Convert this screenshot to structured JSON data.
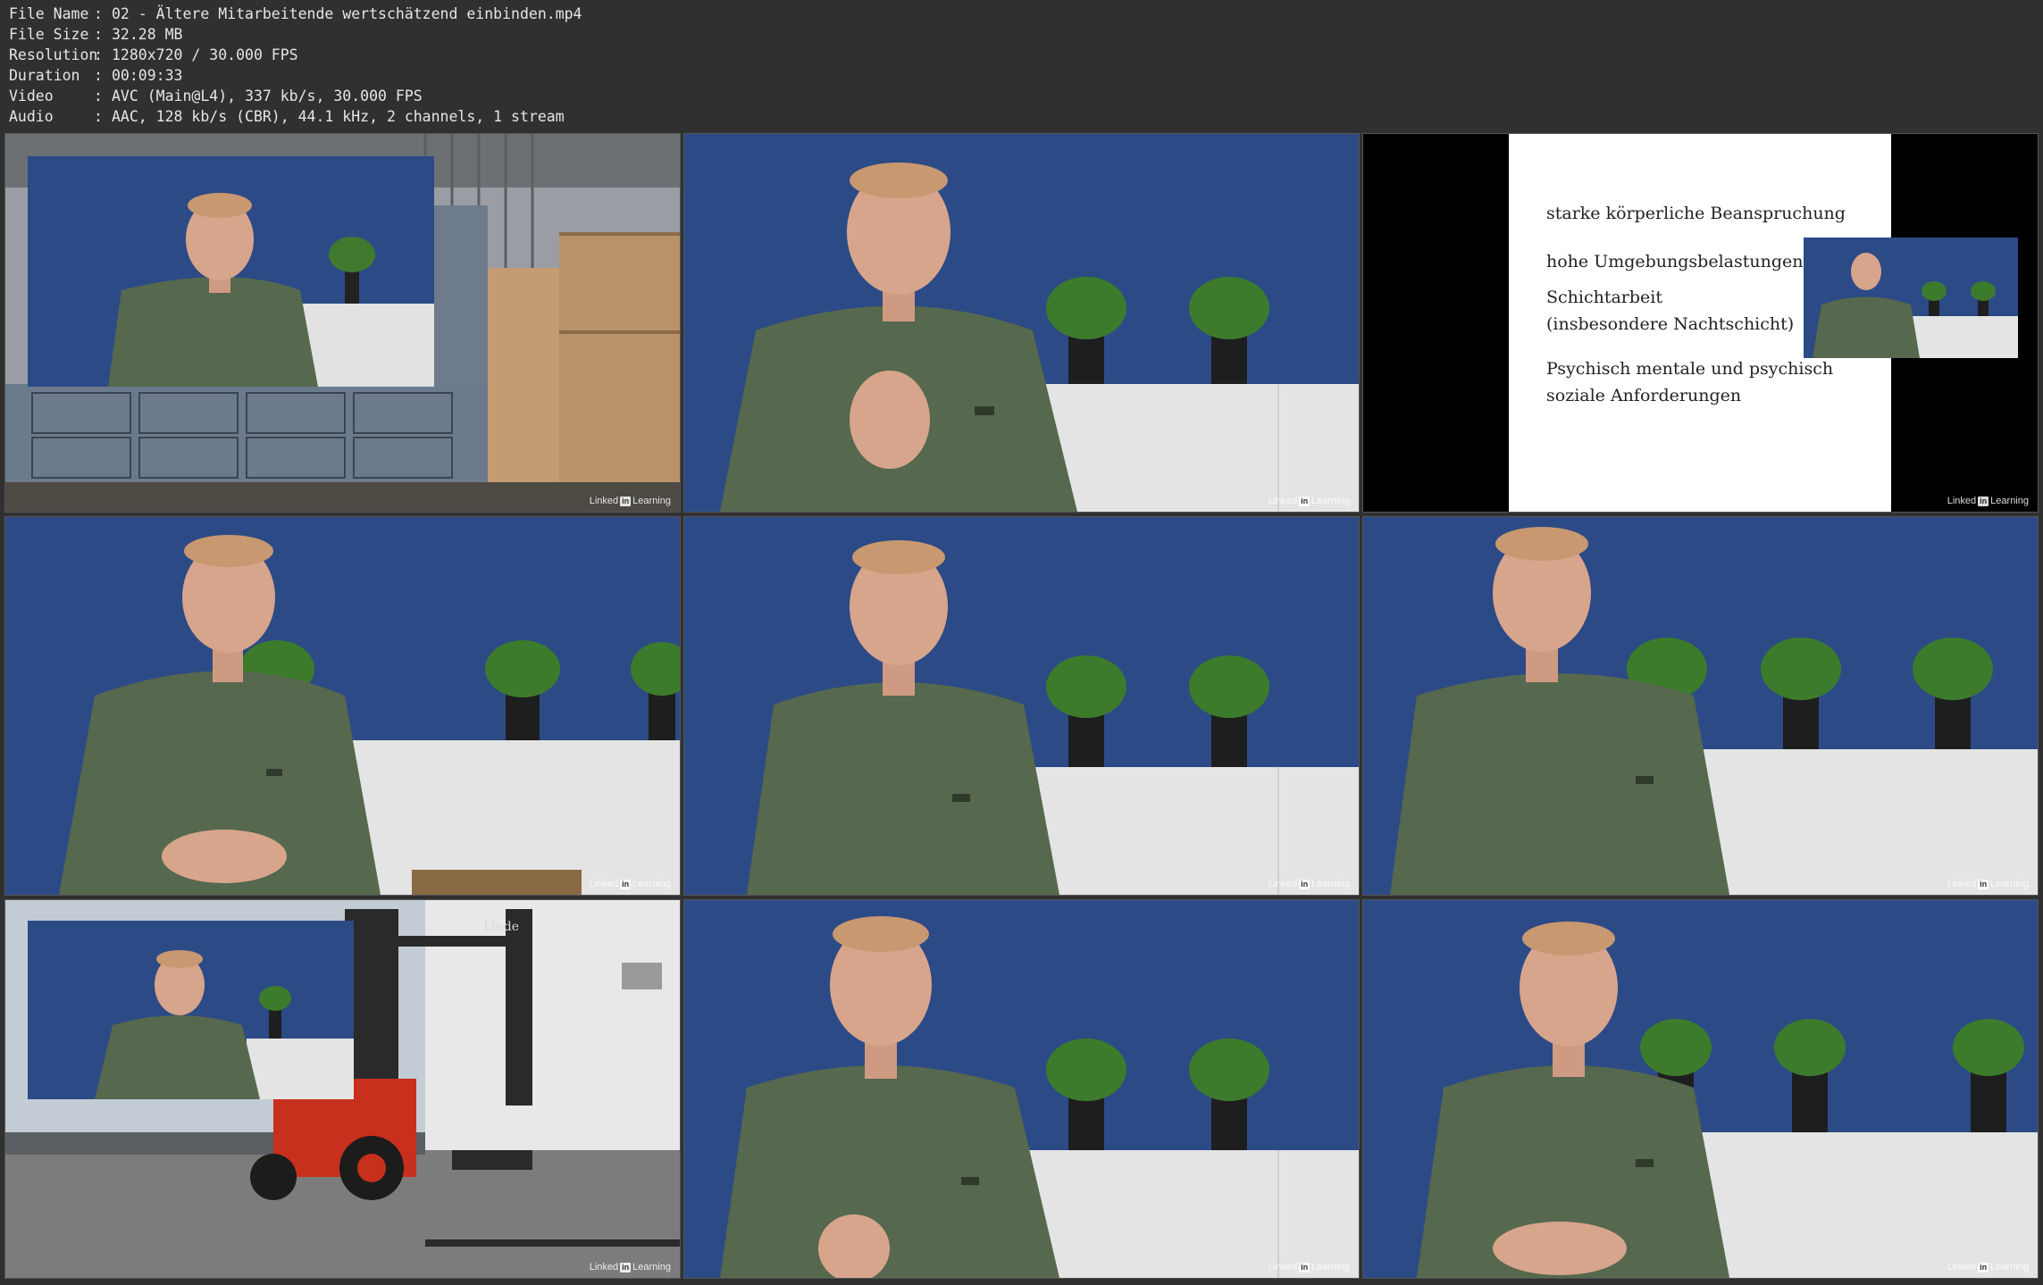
{
  "meta": {
    "rows": [
      {
        "key": "File Name",
        "value": "02 - Ältere Mitarbeitende wertschätzend einbinden.mp4"
      },
      {
        "key": "File Size",
        "value": "32.28 MB"
      },
      {
        "key": "Resolution",
        "value": "1280x720 / 30.000 FPS"
      },
      {
        "key": "Duration",
        "value": "00:09:33"
      },
      {
        "key": "Video",
        "value": "AVC (Main@L4), 337 kb/s, 30.000 FPS"
      },
      {
        "key": "Audio",
        "value": "AAC, 128 kb/s (CBR), 44.1 kHz, 2 channels, 1 stream"
      }
    ],
    "separator": ":"
  },
  "watermark": {
    "brand": "Linked",
    "badge": "in",
    "suffix": "Learning"
  },
  "slide": {
    "items": [
      "starke körperliche Beanspruchung",
      "hohe Umgebungsbelastungen",
      "Schichtarbeit",
      "(insbesondere Nachtschicht)",
      "Psychisch mentale und psychisch",
      "soziale Anforderungen"
    ]
  },
  "forklift_brand": "Linde",
  "colors": {
    "background": "#303030",
    "studio_wall": "#2c4a86",
    "shirt": "#56684e",
    "skin": "#d7a58c",
    "cabinet": "#e4e4e4",
    "forklift_red": "#c7301c"
  }
}
